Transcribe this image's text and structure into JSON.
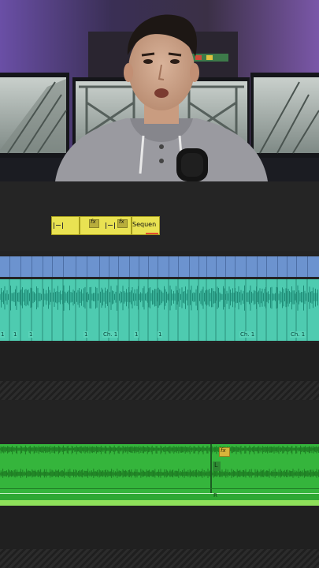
{
  "title_clip": {
    "fx_badges": [
      "fx",
      "fx"
    ],
    "label": "Sequen"
  },
  "audio_track_1": {
    "clip_labels": [
      "1",
      "1",
      "1",
      "1",
      "Ch. 1",
      "1",
      "1",
      "Ch. 1",
      "Ch. 1"
    ]
  },
  "audio_track_2": {
    "fx_badge": "fx",
    "marker_letter": "L",
    "bottom_letter": "R"
  },
  "colors": {
    "video_track": "#6c93cf",
    "audio_cyan": "#4ecbb0",
    "audio_green": "#35b53c",
    "title_yellow": "#e9e252",
    "timeline_bg": "#232323"
  }
}
